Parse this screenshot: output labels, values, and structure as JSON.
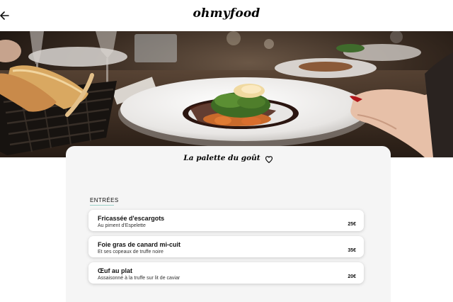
{
  "header": {
    "logo": "ohmyfood",
    "back_icon": "arrow-left-icon"
  },
  "restaurant": {
    "name": "La palette du goût",
    "favorite_icon": "heart-outline-icon"
  },
  "menu": {
    "section": "ENTRÉES",
    "items": [
      {
        "name": "Fricassée d'escargots",
        "description": "Au piment d'Espelette",
        "price": "25€"
      },
      {
        "name": "Foie gras de canard mi-cuit",
        "description": "Et ses copeaux de truffe noire",
        "price": "35€"
      },
      {
        "name": "Œuf au plat",
        "description": "Assaisonné à la truffe sur lit de caviar",
        "price": "20€"
      }
    ]
  },
  "colors": {
    "accent": "#99e2d0",
    "card_bg": "#f5f5f5"
  }
}
